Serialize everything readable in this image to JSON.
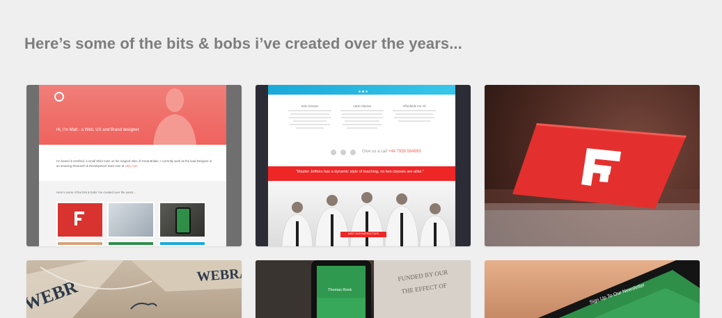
{
  "heading": "Here’s some of the bits & bobs i’ve created over the years...",
  "colors": {
    "background": "#efefef",
    "coral": "#f0625e",
    "red": "#ee2626",
    "cyan": "#1aa9d8",
    "green": "#2f8f49"
  },
  "portfolio": [
    {
      "name": "personal-portfolio-site",
      "hero_text": "Hi, I’m Matt - a Web, UX and Brand designer.",
      "bio": "I’m based in Hertford, a small Shire town on the magical Isles of Great Britain. I currently work as the lead Designer in an amazing Research & Development team over at",
      "bio_link": "UDL.com",
      "subheading": "Here’s some of the bits & bobs I’ve created over the years..."
    },
    {
      "name": "martial-arts-site",
      "columns": [
        "Kids Classes",
        "Adult Classes",
        "Affordable For All"
      ],
      "call_label": "Give us a call",
      "phone": "+44 7939 564893",
      "banner_text": "“Master Jeffries has a dynamic style of teaching, no two classes are alike.”",
      "cta": "MEET OUR INSTRUCTORS"
    },
    {
      "name": "business-card-photo"
    },
    {
      "name": "zebra-stationery-photo"
    },
    {
      "name": "mobile-app-photo",
      "app_title": "Thomas Ronk"
    },
    {
      "name": "tablet-newsletter-photo",
      "overlay_text": "Sign Up To Our Newsletter"
    }
  ]
}
